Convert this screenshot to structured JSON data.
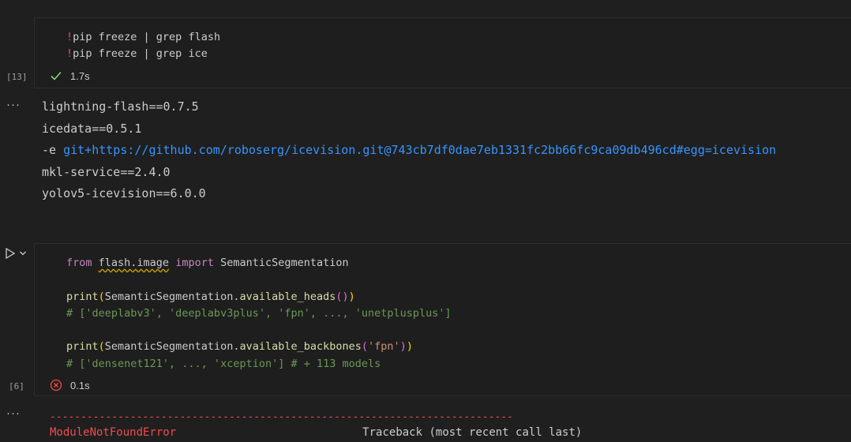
{
  "cell1": {
    "code": {
      "line1": {
        "bang": "!",
        "rest": "pip freeze | grep flash"
      },
      "line2": {
        "bang": "!",
        "rest": "pip freeze | grep ice"
      }
    },
    "exec_count": "[13]",
    "status_icon": "check-icon",
    "time": "1.7s"
  },
  "output1": {
    "more": "···",
    "lines": [
      "lightning-flash==0.7.5",
      "icedata==0.5.1"
    ],
    "editable_prefix": "-e ",
    "editable_link": "git+https://github.com/roboserg/icevision.git@743cb7df0dae7eb1331fc2bb66fc9ca09db496cd#egg=icevision",
    "lines_after": [
      "mkl-service==2.4.0",
      "yolov5-icevision==6.0.0"
    ]
  },
  "cell2": {
    "run_icon": "play-icon",
    "chevron_icon": "chevron-down-icon",
    "code": {
      "l1_from": "from",
      "l1_module": "flash.image",
      "l1_import": "import",
      "l1_name": "SemanticSegmentation",
      "l2_print": "print",
      "l2_open": "(",
      "l2_obj": "SemanticSegmentation.",
      "l2_fn": "available_heads",
      "l2_inner": "()",
      "l2_close": ")",
      "l3_comment": "# ['deeplabv3', 'deeplabv3plus', 'fpn', ..., 'unetplusplus']",
      "l4_print": "print",
      "l4_open": "(",
      "l4_obj": "SemanticSegmentation.",
      "l4_fn": "available_backbones",
      "l4_inner_open": "(",
      "l4_str": "'fpn'",
      "l4_inner_close": ")",
      "l4_close": ")",
      "l5_comment": "# ['densenet121', ..., 'xception'] # + 113 models"
    },
    "exec_count": "[6]",
    "status_icon": "error-circle-icon",
    "time": "0.1s"
  },
  "output2": {
    "more": "···",
    "dashes": "---------------------------------------------------------------------------",
    "error_name": "ModuleNotFoundError",
    "traceback": "Traceback (most recent call last)"
  },
  "colors": {
    "background": "#1f1f1f",
    "cell_background": "#1e1e1e",
    "keyword": "#c586c0",
    "function": "#dcdcaa",
    "string": "#ce9178",
    "comment": "#6a9955",
    "link": "#3794ff",
    "error": "#f14c4c",
    "success": "#89d185"
  }
}
